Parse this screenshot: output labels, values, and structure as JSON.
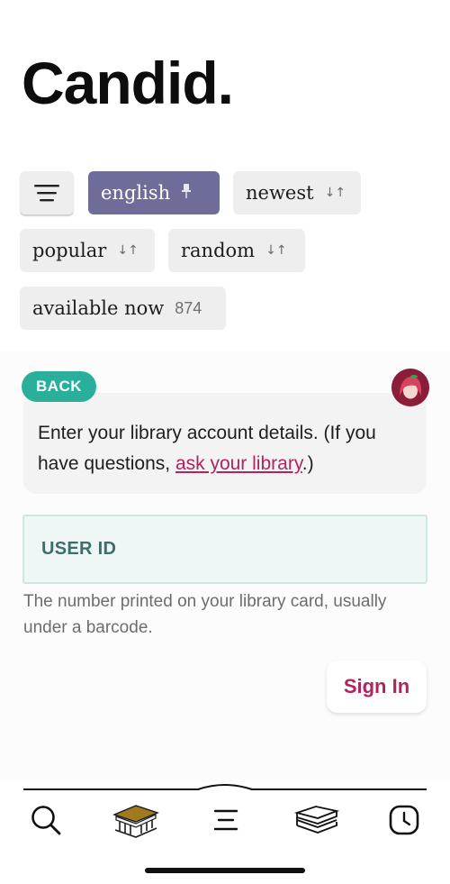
{
  "app": {
    "title": "Candid."
  },
  "filters": {
    "menu_icon": "hamburger-icon",
    "chips": [
      {
        "label": "english",
        "icon": "pin-icon",
        "active": true
      },
      {
        "label": "newest",
        "icon": "sort-arrows-icon",
        "active": false
      },
      {
        "label": "popular",
        "icon": "sort-arrows-icon",
        "active": false
      },
      {
        "label": "random",
        "icon": "sort-arrows-icon",
        "active": false
      },
      {
        "label": "available now",
        "count": "874",
        "active": false
      }
    ]
  },
  "signin_flow": {
    "back_label": "BACK",
    "message_before": "Enter your library account details. (If you have questions, ",
    "message_link": "ask your library",
    "message_after": ".)",
    "field_label": "USER ID",
    "hint": "The number printed on your library card, usually under a barcode.",
    "submit_label": "Sign In"
  },
  "tabbar": {
    "items": [
      {
        "name": "search",
        "icon": "search-icon"
      },
      {
        "name": "library",
        "icon": "library-building-icon",
        "active": true
      },
      {
        "name": "menu",
        "icon": "menu-lines-icon"
      },
      {
        "name": "shelf",
        "icon": "books-stack-icon"
      },
      {
        "name": "history",
        "icon": "clock-icon"
      }
    ]
  },
  "colors": {
    "accent_active_chip": "#6e6d9a",
    "back_button": "#2aaf9c",
    "link": "#b0245f",
    "avatar_bg": "#8b1d3a"
  }
}
